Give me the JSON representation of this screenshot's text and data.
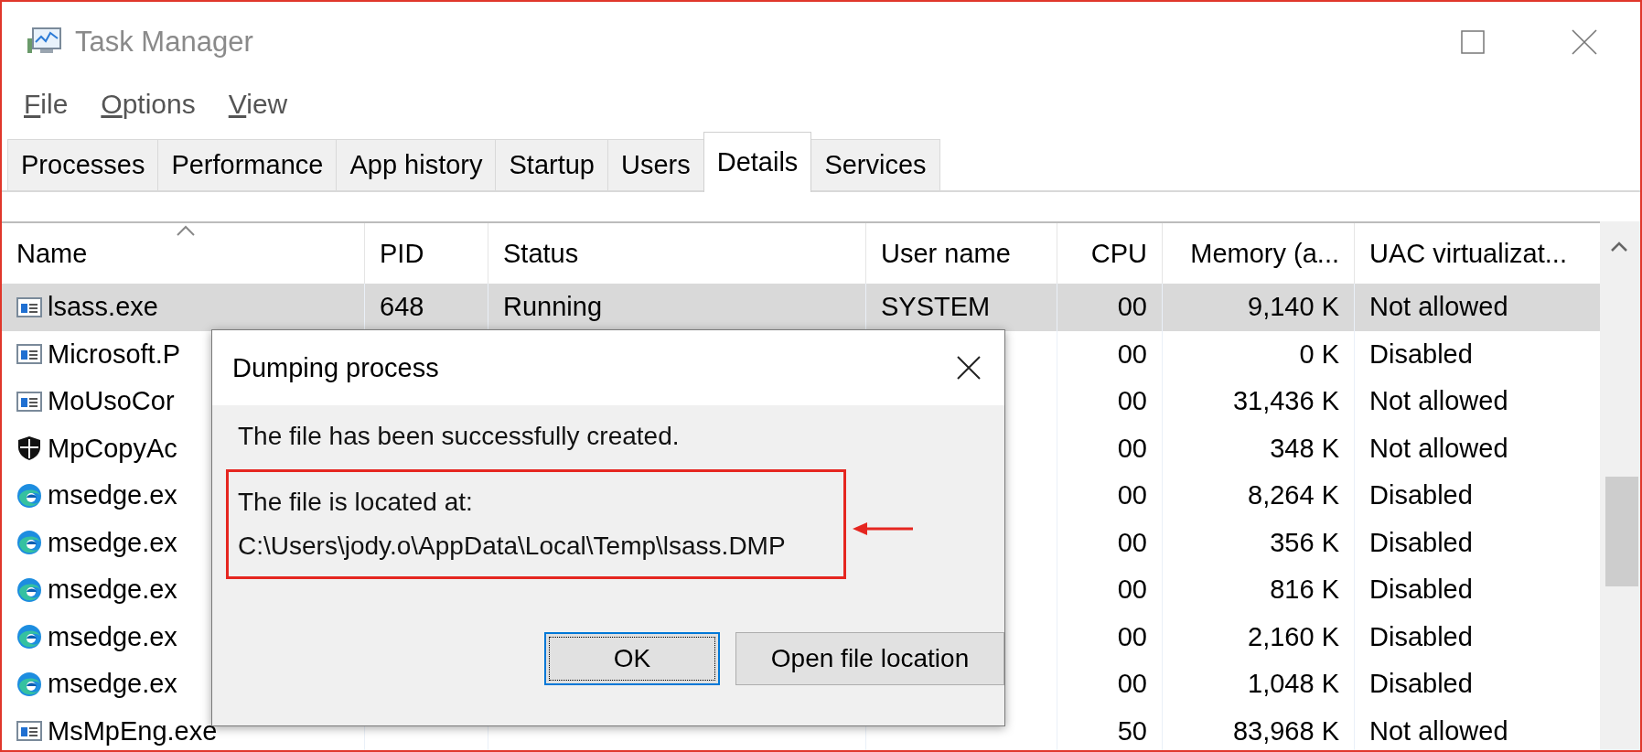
{
  "window": {
    "title": "Task Manager"
  },
  "menu": [
    "File",
    "Options",
    "View"
  ],
  "tabs": [
    {
      "label": "Processes",
      "selected": false
    },
    {
      "label": "Performance",
      "selected": false
    },
    {
      "label": "App history",
      "selected": false
    },
    {
      "label": "Startup",
      "selected": false
    },
    {
      "label": "Users",
      "selected": false
    },
    {
      "label": "Details",
      "selected": true
    },
    {
      "label": "Services",
      "selected": false
    }
  ],
  "table": {
    "columns": [
      {
        "label": "Name",
        "sorted": true
      },
      {
        "label": "PID",
        "sorted": false
      },
      {
        "label": "Status",
        "sorted": false
      },
      {
        "label": "User name",
        "sorted": false
      },
      {
        "label": "CPU",
        "sorted": false
      },
      {
        "label": "Memory (a...",
        "sorted": false
      },
      {
        "label": "UAC virtualizat...",
        "sorted": false
      }
    ],
    "rows": [
      {
        "kind": "window",
        "name": "lsass.exe",
        "pid": "648",
        "status": "Running",
        "user": "SYSTEM",
        "cpu": "00",
        "memory": "9,140 K",
        "uac": "Not allowed",
        "selected": true
      },
      {
        "kind": "window",
        "name": "Microsoft.P",
        "cpu": "00",
        "memory": "0 K",
        "uac": "Disabled",
        "selected": false
      },
      {
        "kind": "window",
        "name": "MoUsoCor",
        "cpu": "00",
        "memory": "31,436 K",
        "uac": "Not allowed",
        "selected": false
      },
      {
        "kind": "shield",
        "name": "MpCopyAc",
        "cpu": "00",
        "memory": "348 K",
        "uac": "Not allowed",
        "selected": false
      },
      {
        "kind": "edge",
        "name": "msedge.ex",
        "cpu": "00",
        "memory": "8,264 K",
        "uac": "Disabled",
        "selected": false
      },
      {
        "kind": "edge",
        "name": "msedge.ex",
        "cpu": "00",
        "memory": "356 K",
        "uac": "Disabled",
        "selected": false
      },
      {
        "kind": "edge",
        "name": "msedge.ex",
        "cpu": "00",
        "memory": "816 K",
        "uac": "Disabled",
        "selected": false
      },
      {
        "kind": "edge",
        "name": "msedge.ex",
        "cpu": "00",
        "memory": "2,160 K",
        "uac": "Disabled",
        "selected": false
      },
      {
        "kind": "edge",
        "name": "msedge.ex",
        "cpu": "00",
        "memory": "1,048 K",
        "uac": "Disabled",
        "selected": false
      },
      {
        "kind": "window",
        "name": "MsMpEng.exe",
        "cpu": "50",
        "memory": "83,968 K",
        "uac": "Not allowed",
        "selected": false
      }
    ]
  },
  "dialog": {
    "title": "Dumping process",
    "message": "The file has been successfully created.",
    "highlight": {
      "label": "The file is located at:",
      "path": "C:\\Users\\jody.o\\AppData\\Local\\Temp\\lsass.DMP"
    },
    "buttons": [
      {
        "label": "OK",
        "default": true
      },
      {
        "label": "Open file location",
        "default": false
      }
    ]
  }
}
